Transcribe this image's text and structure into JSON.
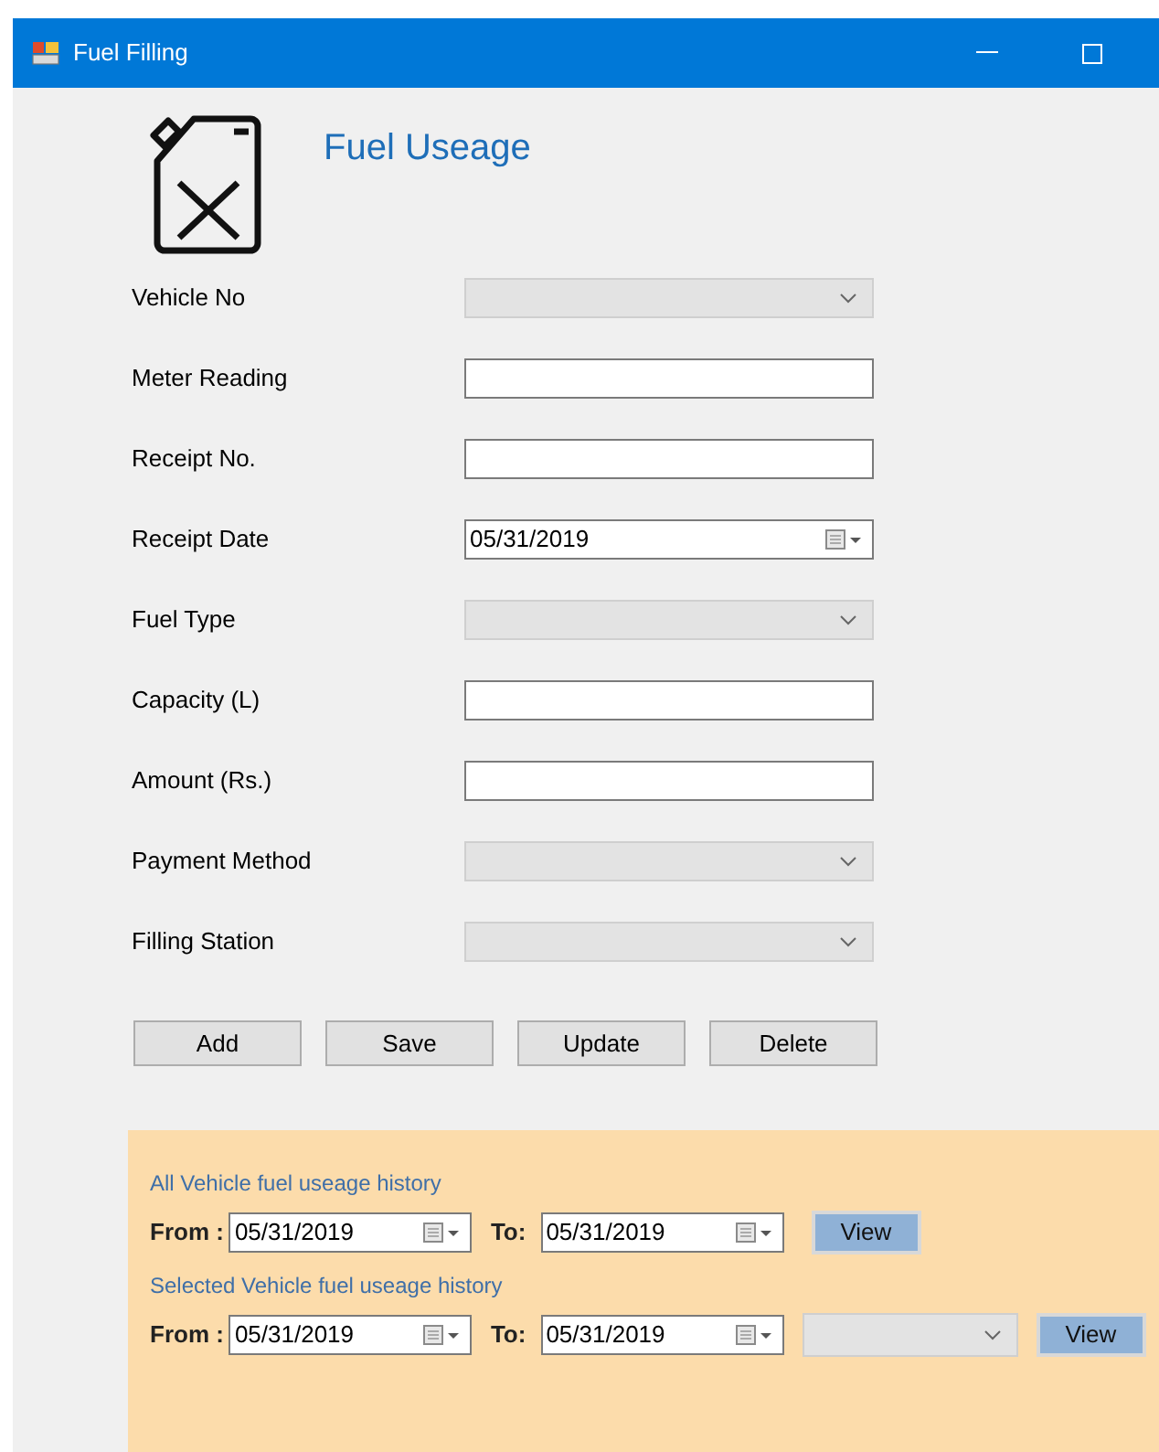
{
  "window": {
    "title": "Fuel Filling"
  },
  "heading": "Fuel Useage",
  "fields": [
    {
      "label": "Vehicle No",
      "kind": "combo"
    },
    {
      "label": "Meter Reading",
      "kind": "text"
    },
    {
      "label": "Receipt No.",
      "kind": "text"
    },
    {
      "label": "Receipt Date",
      "kind": "date",
      "value": "05/31/2019"
    },
    {
      "label": "Fuel Type",
      "kind": "combo"
    },
    {
      "label": "Capacity (L)",
      "kind": "text"
    },
    {
      "label": "Amount (Rs.)",
      "kind": "text"
    },
    {
      "label": "Payment Method",
      "kind": "combo"
    },
    {
      "label": "Filling Station",
      "kind": "combo"
    }
  ],
  "buttons": [
    "Add",
    "Save",
    "Update",
    "Delete"
  ],
  "history": [
    {
      "title": "All Vehicle fuel useage history",
      "from_label": "From :",
      "from": "05/31/2019",
      "to_label": "To:",
      "to": "05/31/2019",
      "has_vehicle_combo": false,
      "button": "View"
    },
    {
      "title": "Selected Vehicle fuel useage history",
      "from_label": "From :",
      "from": "05/31/2019",
      "to_label": "To:",
      "to": "05/31/2019",
      "has_vehicle_combo": true,
      "button": "View"
    }
  ]
}
